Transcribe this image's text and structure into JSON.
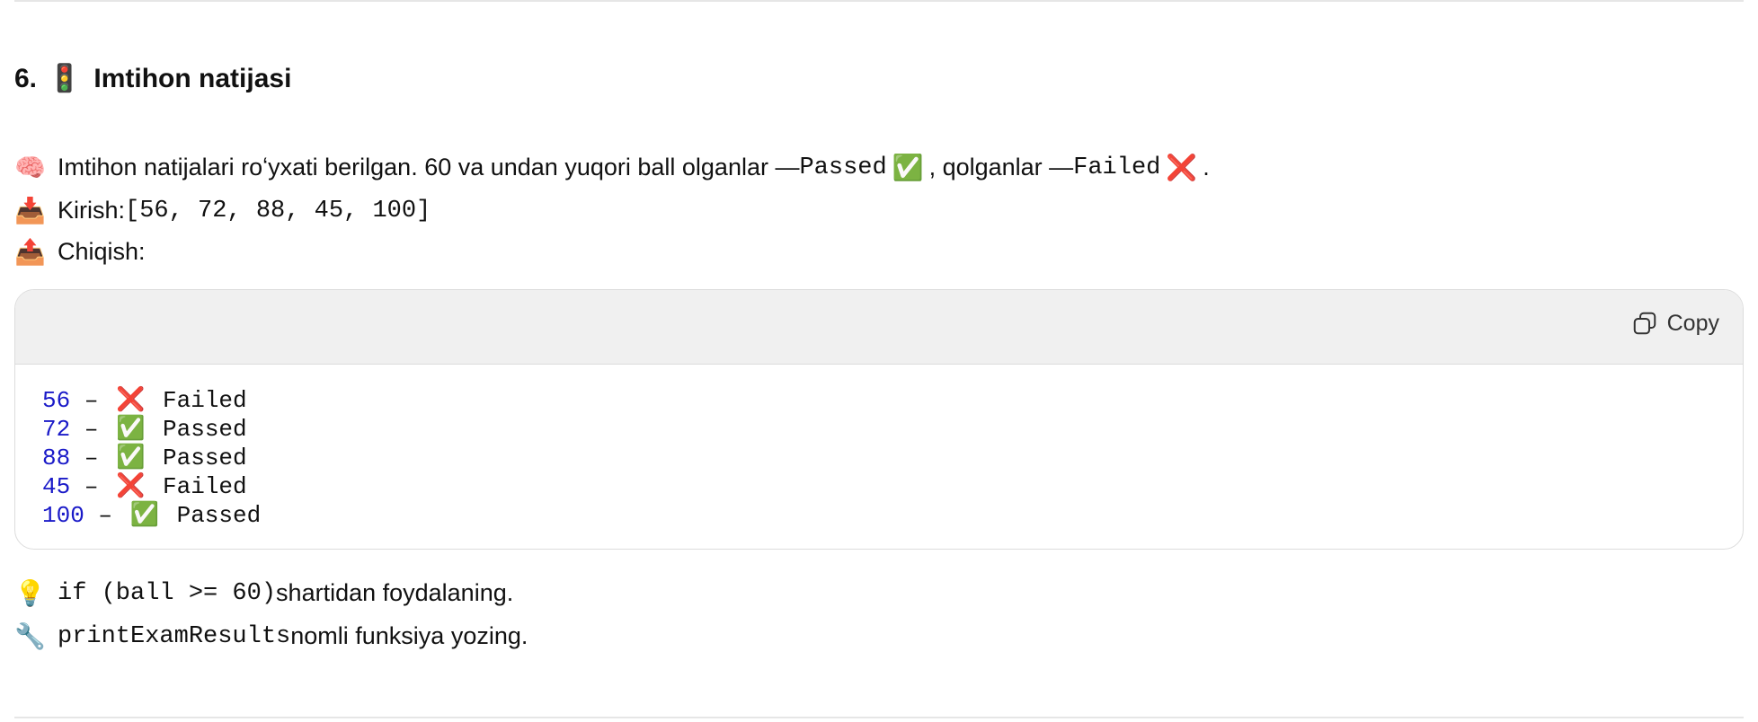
{
  "section": {
    "number": "6.",
    "title_emoji": "🚦",
    "title": "Imtihon natijasi"
  },
  "intro": {
    "emoji": "🧠",
    "text_a": "Imtihon natijalari roʻyxati berilgan. 60 va undan yuqori ball olganlar — ",
    "passed_code": "Passed",
    "passed_emoji": "✅",
    "text_b": ", qolganlar — ",
    "failed_code": "Failed",
    "failed_emoji": "❌",
    "text_c": "."
  },
  "input": {
    "emoji": "📥",
    "label": "Kirish: ",
    "value": "[56, 72, 88, 45, 100]"
  },
  "output": {
    "emoji": "📤",
    "label": "Chiqish:"
  },
  "code_block": {
    "copy_label": "Copy",
    "lines": [
      {
        "num": "56",
        "sep": " – ",
        "emoji": "❌",
        "status": " Failed"
      },
      {
        "num": "72",
        "sep": " – ",
        "emoji": "✅",
        "status": " Passed"
      },
      {
        "num": "88",
        "sep": " – ",
        "emoji": "✅",
        "status": " Passed"
      },
      {
        "num": "45",
        "sep": " – ",
        "emoji": "❌",
        "status": " Failed"
      },
      {
        "num": "100",
        "sep": " – ",
        "emoji": "✅",
        "status": " Passed"
      }
    ]
  },
  "hint": {
    "emoji": "💡",
    "code": "if (ball >= 60)",
    "text": " shartidan foydalaning."
  },
  "task": {
    "emoji": "🔧",
    "code": "printExamResults",
    "text": " nomli funksiya yozing."
  }
}
